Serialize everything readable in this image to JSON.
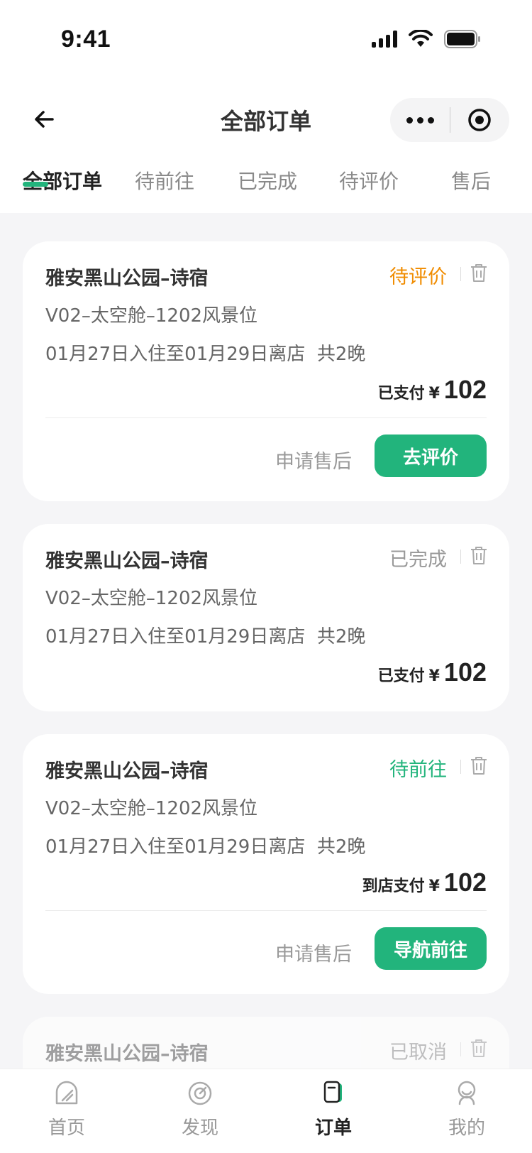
{
  "status_bar": {
    "time": "9:41"
  },
  "nav": {
    "title": "全部订单"
  },
  "tabs": [
    {
      "label": "全部订单",
      "active": true
    },
    {
      "label": "待前往",
      "active": false
    },
    {
      "label": "已完成",
      "active": false
    },
    {
      "label": "待评价",
      "active": false
    },
    {
      "label": "售后",
      "active": false
    }
  ],
  "orders": [
    {
      "hotel": "雅安黑山公园–诗宿",
      "status": "待评价",
      "status_color": "#f08c00",
      "room": "V02–太空舱–1202风景位",
      "dates": "01月27日入住至01月29日离店  共2晚",
      "pay_label": "已支付",
      "currency": "¥",
      "amount": "102",
      "secondary_action": "申请售后",
      "primary_action": "去评价"
    },
    {
      "hotel": "雅安黑山公园–诗宿",
      "status": "已完成",
      "status_color": "#999999",
      "room": "V02–太空舱–1202风景位",
      "dates": "01月27日入住至01月29日离店  共2晚",
      "pay_label": "已支付",
      "currency": "¥",
      "amount": "102"
    },
    {
      "hotel": "雅安黑山公园–诗宿",
      "status": "待前往",
      "status_color": "#22b47c",
      "room": "V02–太空舱–1202风景位",
      "dates": "01月27日入住至01月29日离店  共2晚",
      "pay_label": "到店支付",
      "currency": "¥",
      "amount": "102",
      "secondary_action": "申请售后",
      "primary_action": "导航前往"
    },
    {
      "hotel": "雅安黑山公园–诗宿",
      "status": "已取消",
      "status_color": "#999999"
    }
  ],
  "tabbar": [
    {
      "label": "首页",
      "icon": "home-icon",
      "active": false
    },
    {
      "label": "发现",
      "icon": "compass-icon",
      "active": false
    },
    {
      "label": "订单",
      "icon": "order-icon",
      "active": true
    },
    {
      "label": "我的",
      "icon": "profile-icon",
      "active": false
    }
  ],
  "colors": {
    "accent": "#22b47c",
    "pending_review": "#f08c00",
    "muted": "#999999"
  }
}
